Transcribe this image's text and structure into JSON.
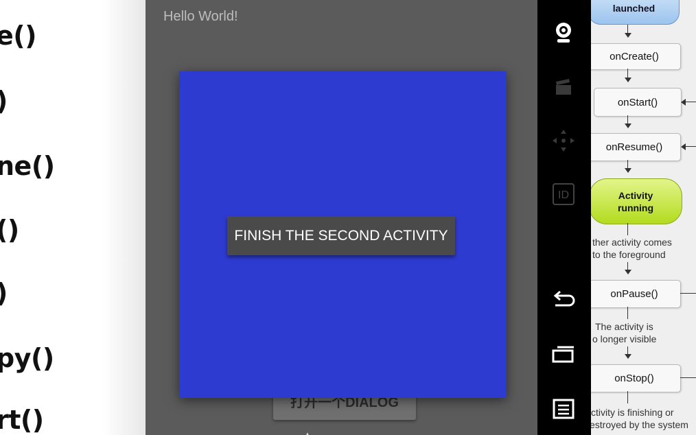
{
  "left_panel": {
    "methods": [
      "e()",
      ")",
      "ne()",
      "()",
      ")",
      "py()",
      "rt()"
    ]
  },
  "emulator": {
    "hello_text": "Hello World!",
    "behind_button_label": "打开一个DIALOG",
    "dialog": {
      "color": "#2e3bd0",
      "finish_button_label": "FINISH THE SECOND ACTIVITY"
    }
  },
  "navbar": {
    "icons": [
      "camera-icon",
      "clapperboard-icon",
      "dpad-icon",
      "id-icon",
      "back-icon",
      "recent-apps-icon",
      "menu-icon"
    ],
    "id_label": "ID"
  },
  "lifecycle_diagram": {
    "start_label": "launched",
    "boxes": [
      "onCreate()",
      "onStart()",
      "onResume()",
      "onPause()",
      "onStop()"
    ],
    "running_label_line1": "Activity",
    "running_label_line2": "running",
    "notes": {
      "foreground_1": "ther activity comes",
      "foreground_2": "to the foreground",
      "invisible_1": "The activity is",
      "invisible_2": "o longer visible",
      "finishing_1": "ctivity is finishing or",
      "finishing_2": "estroyed by the system"
    },
    "colors": {
      "start": "#9cc4ee",
      "running": "#b3db1e"
    }
  }
}
